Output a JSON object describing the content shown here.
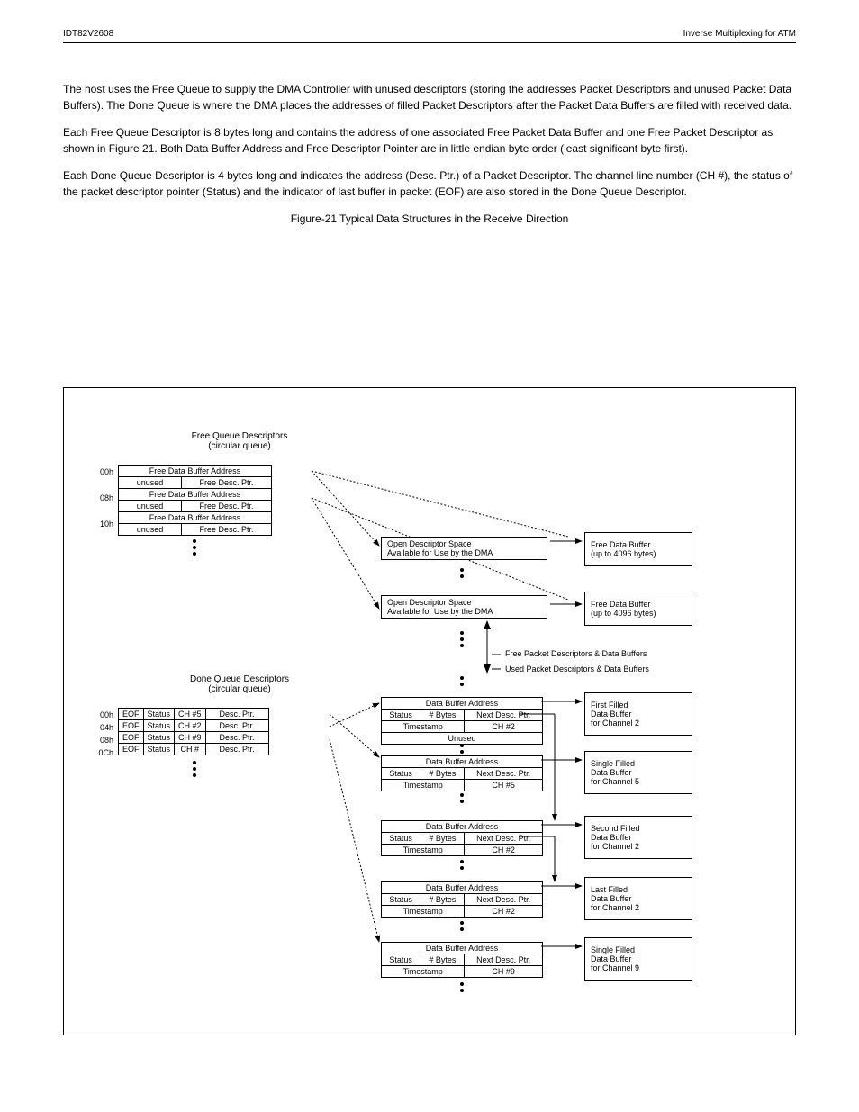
{
  "header": {
    "product": "IDT82V2608",
    "title": "Inverse Multiplexing for ATM"
  },
  "paragraphs": {
    "p1": "The host uses the Free Queue to supply the DMA Controller with unused descriptors (storing the addresses Packet Descriptors and unused Packet Data Buffers). The Done Queue is where the DMA places the addresses of filled Packet Descriptors after the Packet Data Buffers are filled with received data.",
    "p2": "Each Free Queue Descriptor is 8 bytes long and contains the address of one associated Free Packet Data Buffer and one Free Packet Descriptor as shown in Figure 21. Both Data Buffer Address and Free Descriptor Pointer are in little endian byte order (least significant byte first).",
    "p3": "Each Done Queue Descriptor is 4 bytes long and indicates the address (Desc. Ptr.) of a Packet Descriptor. The channel line number (CH #), the status of the packet descriptor pointer (Status) and the indicator of last buffer in packet (EOF) are also stored in the Done Queue Descriptor."
  },
  "figure": {
    "caption": "Figure-21 Typical Data Structures in the Receive Direction",
    "freeQueue": {
      "title": "Free Queue Descriptors",
      "subtitle": "(circular queue)",
      "rows": [
        {
          "offset": "00h",
          "top": "Free Data Buffer Address",
          "left": "unused",
          "right": "Free Desc. Ptr."
        },
        {
          "offset": "08h",
          "top": "Free Data Buffer Address",
          "left": "unused",
          "right": "Free Desc. Ptr."
        },
        {
          "offset": "10h",
          "top": "Free Data Buffer Address",
          "left": "unused",
          "right": "Free Desc. Ptr."
        }
      ]
    },
    "doneQueue": {
      "title": "Done Queue Descriptors",
      "subtitle": "(circular queue)",
      "headers": [
        "EOF",
        "Status",
        "CH #",
        "Desc. Ptr."
      ],
      "rows": [
        {
          "offset": "00h",
          "c0": "EOF",
          "c1": "Status",
          "c2": "CH #5",
          "c3": "Desc. Ptr."
        },
        {
          "offset": "04h",
          "c0": "EOF",
          "c1": "Status",
          "c2": "CH #2",
          "c3": "Desc. Ptr."
        },
        {
          "offset": "08h",
          "c0": "EOF",
          "c1": "Status",
          "c2": "CH #9",
          "c3": "Desc. Ptr."
        },
        {
          "offset": "0Ch",
          "c0": "EOF",
          "c1": "Status",
          "c2": "CH #",
          "c3": "Desc. Ptr."
        }
      ]
    },
    "openDesc": {
      "line1": "Open Descriptor Space",
      "line2": "Available for Use by the DMA"
    },
    "freeBuf": {
      "line1": "Free Data Buffer",
      "line2": "(up to 4096 bytes)"
    },
    "packetDesc": {
      "r0": "Data Buffer Address",
      "status": "Status",
      "bytes": "# Bytes",
      "next": "Next Desc. Ptr.",
      "ts": "Timestamp",
      "unused": "Unused"
    },
    "channels": {
      "ch2": "CH #2",
      "ch5": "CH #5",
      "ch9": "CH #9"
    },
    "bufLabels": {
      "b1a": "First Filled",
      "b1b": "Data Buffer",
      "b1c": "for Channel 2",
      "b2a": "Single Filled",
      "b2b": "Data Buffer",
      "b2c": "for Channel 5",
      "b3a": "Second Filled",
      "b3b": "Data Buffer",
      "b3c": "for Channel 2",
      "b4a": "Last Filled",
      "b4b": "Data Buffer",
      "b4c": "for Channel 2",
      "b5a": "Single Filled",
      "b5b": "Data Buffer",
      "b5c": "for Channel 9"
    },
    "legend": {
      "free": "Free Packet Descriptors & Data Buffers",
      "used": "Used Packet Descriptors & Data Buffers"
    }
  }
}
